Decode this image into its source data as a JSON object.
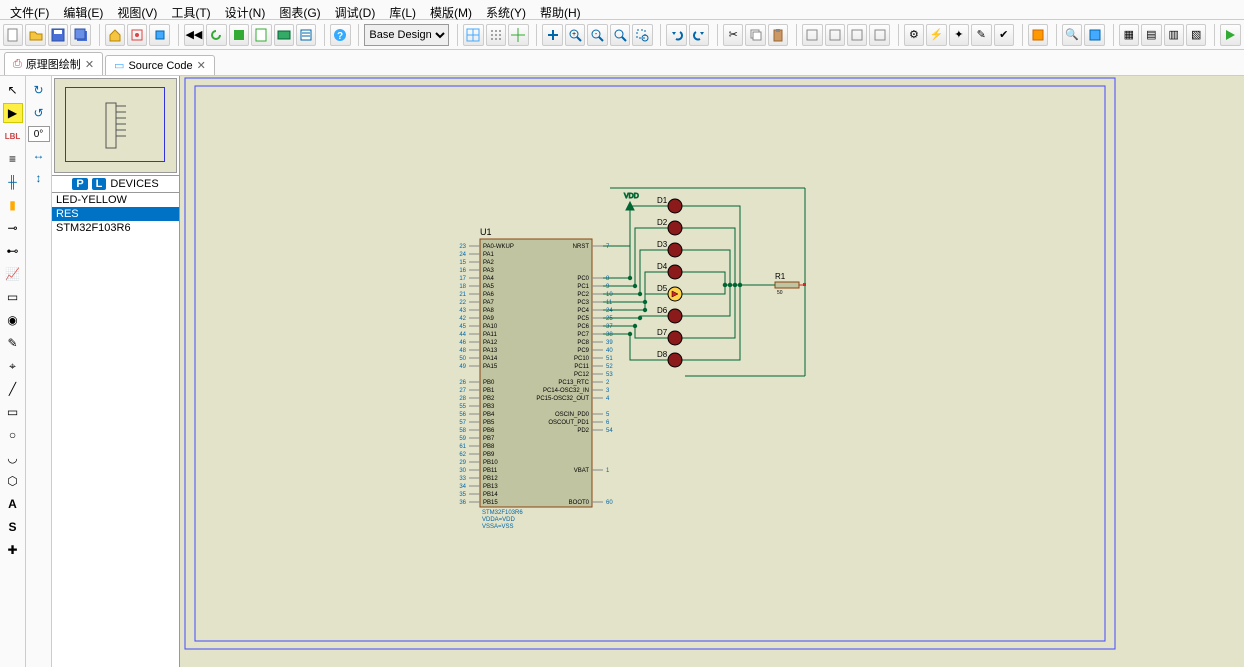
{
  "menu": {
    "file": "文件(F)",
    "edit": "编辑(E)",
    "view": "视图(V)",
    "tool": "工具(T)",
    "design": "设计(N)",
    "chart": "图表(G)",
    "debug": "调试(D)",
    "library": "库(L)",
    "template": "模版(M)",
    "system": "系统(Y)",
    "help": "帮助(H)"
  },
  "toolbar": {
    "design_mode": "Base Design"
  },
  "tabs": {
    "schematic": "原理图绘制",
    "source": "Source Code"
  },
  "aux": {
    "angle": "0°"
  },
  "devices": {
    "header_label": "DEVICES",
    "items": [
      "LED-YELLOW",
      "RES",
      "STM32F103R6"
    ]
  },
  "schematic": {
    "mcu": {
      "ref": "U1",
      "vdd": "VDD",
      "left_pins": [
        {
          "n": "23",
          "lbl": "PA0-WKUP"
        },
        {
          "n": "24",
          "lbl": "PA1"
        },
        {
          "n": "15",
          "lbl": "PA2"
        },
        {
          "n": "16",
          "lbl": "PA3"
        },
        {
          "n": "17",
          "lbl": "PA4"
        },
        {
          "n": "18",
          "lbl": "PA5"
        },
        {
          "n": "21",
          "lbl": "PA6"
        },
        {
          "n": "22",
          "lbl": "PA7"
        },
        {
          "n": "43",
          "lbl": "PA8"
        },
        {
          "n": "42",
          "lbl": "PA9"
        },
        {
          "n": "45",
          "lbl": "PA10"
        },
        {
          "n": "44",
          "lbl": "PA11"
        },
        {
          "n": "46",
          "lbl": "PA12"
        },
        {
          "n": "48",
          "lbl": "PA13"
        },
        {
          "n": "50",
          "lbl": "PA14"
        },
        {
          "n": "49",
          "lbl": "PA15"
        },
        {
          "n": "",
          "lbl": ""
        },
        {
          "n": "26",
          "lbl": "PB0"
        },
        {
          "n": "27",
          "lbl": "PB1"
        },
        {
          "n": "28",
          "lbl": "PB2"
        },
        {
          "n": "55",
          "lbl": "PB3"
        },
        {
          "n": "56",
          "lbl": "PB4"
        },
        {
          "n": "57",
          "lbl": "PB5"
        },
        {
          "n": "58",
          "lbl": "PB6"
        },
        {
          "n": "59",
          "lbl": "PB7"
        },
        {
          "n": "61",
          "lbl": "PB8"
        },
        {
          "n": "62",
          "lbl": "PB9"
        },
        {
          "n": "29",
          "lbl": "PB10"
        },
        {
          "n": "30",
          "lbl": "PB11"
        },
        {
          "n": "33",
          "lbl": "PB12"
        },
        {
          "n": "34",
          "lbl": "PB13"
        },
        {
          "n": "35",
          "lbl": "PB14"
        },
        {
          "n": "36",
          "lbl": "PB15"
        }
      ],
      "right_pins": [
        {
          "n": "7",
          "lbl": "NRST"
        },
        {
          "n": "",
          "lbl": ""
        },
        {
          "n": "",
          "lbl": ""
        },
        {
          "n": "",
          "lbl": ""
        },
        {
          "n": "8",
          "lbl": "PC0"
        },
        {
          "n": "9",
          "lbl": "PC1"
        },
        {
          "n": "10",
          "lbl": "PC2"
        },
        {
          "n": "11",
          "lbl": "PC3"
        },
        {
          "n": "24",
          "lbl": "PC4"
        },
        {
          "n": "25",
          "lbl": "PC5"
        },
        {
          "n": "37",
          "lbl": "PC6"
        },
        {
          "n": "38",
          "lbl": "PC7"
        },
        {
          "n": "39",
          "lbl": "PC8"
        },
        {
          "n": "40",
          "lbl": "PC9"
        },
        {
          "n": "51",
          "lbl": "PC10"
        },
        {
          "n": "52",
          "lbl": "PC11"
        },
        {
          "n": "53",
          "lbl": "PC12"
        },
        {
          "n": "2",
          "lbl": "PC13_RTC"
        },
        {
          "n": "3",
          "lbl": "PC14-OSC32_IN"
        },
        {
          "n": "4",
          "lbl": "PC15-OSC32_OUT"
        },
        {
          "n": "",
          "lbl": ""
        },
        {
          "n": "5",
          "lbl": "OSCIN_PD0"
        },
        {
          "n": "6",
          "lbl": "OSCOUT_PD1"
        },
        {
          "n": "54",
          "lbl": "PD2"
        },
        {
          "n": "",
          "lbl": ""
        },
        {
          "n": "",
          "lbl": ""
        },
        {
          "n": "",
          "lbl": ""
        },
        {
          "n": "",
          "lbl": ""
        },
        {
          "n": "1",
          "lbl": "VBAT"
        },
        {
          "n": "",
          "lbl": ""
        },
        {
          "n": "",
          "lbl": ""
        },
        {
          "n": "",
          "lbl": ""
        },
        {
          "n": "60",
          "lbl": "BOOT0"
        }
      ],
      "footer": [
        "STM32F103R6",
        "VDDA=VDD",
        "VSSA=VSS"
      ]
    },
    "leds": [
      {
        "ref": "D1"
      },
      {
        "ref": "D2"
      },
      {
        "ref": "D3"
      },
      {
        "ref": "D4"
      },
      {
        "ref": "D5"
      },
      {
        "ref": "D6"
      },
      {
        "ref": "D7"
      },
      {
        "ref": "D8"
      }
    ],
    "resistor": {
      "ref": "R1",
      "val": "50"
    }
  }
}
